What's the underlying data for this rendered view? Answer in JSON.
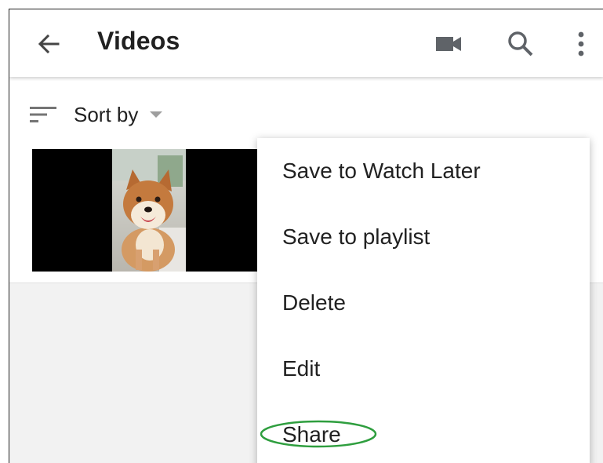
{
  "header": {
    "title": "Videos",
    "back_icon": "arrow-back-icon",
    "camera_icon": "videocam-icon",
    "search_icon": "search-icon",
    "more_icon": "more-vert-icon"
  },
  "toolbar": {
    "sort_label": "Sort by",
    "sort_icon": "sort-icon",
    "sort_caret_icon": "caret-down-icon"
  },
  "video": {
    "thumbnail": "dog-video-thumbnail"
  },
  "menu": {
    "items": [
      {
        "label": "Save to Watch Later"
      },
      {
        "label": "Save to playlist"
      },
      {
        "label": "Delete"
      },
      {
        "label": "Edit"
      },
      {
        "label": "Share"
      }
    ]
  },
  "colors": {
    "accent_annotation": "#2e9e3e",
    "text_primary": "#212121",
    "icon_gray": "#5f6368"
  }
}
